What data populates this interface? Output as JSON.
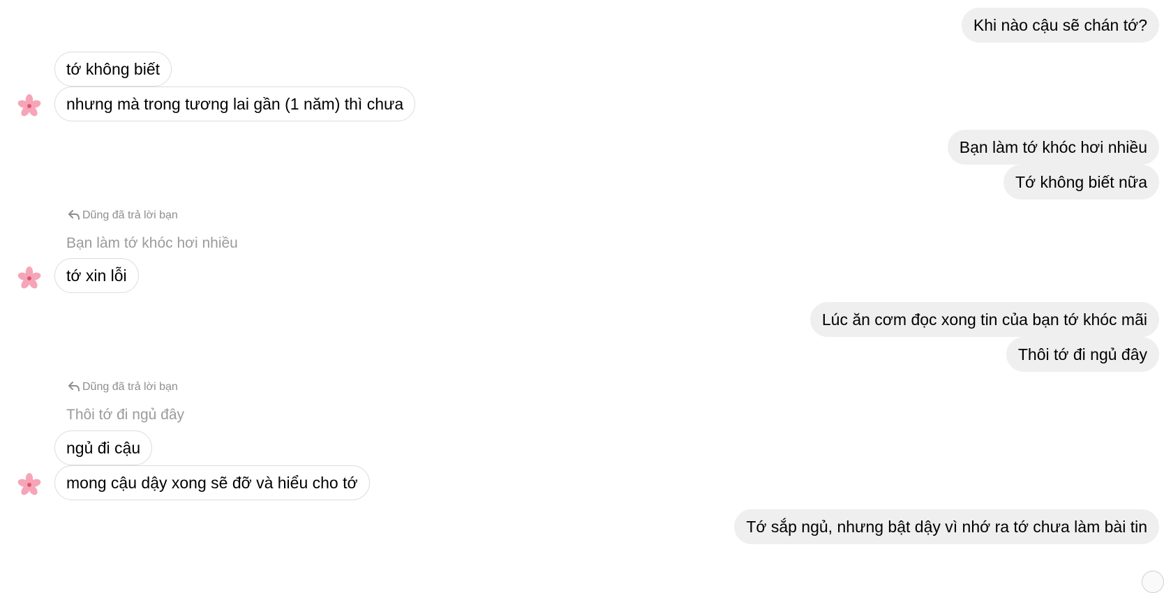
{
  "conversation": {
    "peer_name": "Dũng",
    "reply_notice": "Dũng đã trả lời bạn",
    "messages": [
      {
        "side": "out",
        "text": "Khi nào cậu sẽ chán tớ?"
      },
      {
        "side": "in",
        "text": "tớ không biết"
      },
      {
        "side": "in",
        "text": "nhưng mà trong tương lai gần (1 năm) thì chưa"
      },
      {
        "side": "out",
        "text": "Bạn làm tớ khóc hơi nhiều"
      },
      {
        "side": "out",
        "text": "Tớ không biết nữa"
      },
      {
        "side": "in",
        "text": "tớ xin lỗi",
        "reply_to": "Bạn làm tớ khóc hơi nhiều"
      },
      {
        "side": "out",
        "text": "Lúc ăn cơm đọc xong tin của bạn tớ khóc mãi"
      },
      {
        "side": "out",
        "text": "Thôi tớ đi ngủ đây"
      },
      {
        "side": "in",
        "text": "ngủ đi cậu",
        "reply_to": "Thôi tớ đi ngủ đây"
      },
      {
        "side": "in",
        "text": "mong cậu dậy xong sẽ đỡ và hiểu cho tớ"
      },
      {
        "side": "out",
        "text": "Tớ sắp ngủ, nhưng bật dậy vì nhớ ra tớ chưa làm bài tin"
      }
    ]
  },
  "avatar": {
    "icon": "cherry-blossom-icon",
    "petal_color": "#f6a5b8",
    "center_color": "#e0556e"
  },
  "colors": {
    "outgoing_bubble": "#efefef",
    "incoming_border": "#dcdcdc",
    "reply_text": "#8e8e8e"
  }
}
